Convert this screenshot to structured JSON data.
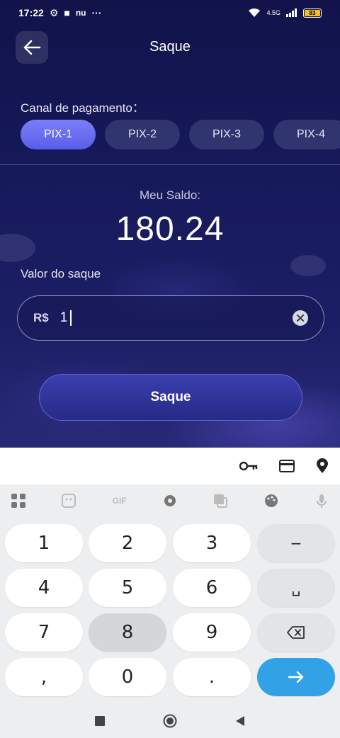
{
  "status_bar": {
    "time": "17:22",
    "network": "4.5G",
    "battery": "83"
  },
  "header": {
    "back_icon": "arrow-left-icon",
    "title": "Saque"
  },
  "payment": {
    "label": "Canal de pagamento：",
    "channels": [
      "PIX-1",
      "PIX-2",
      "PIX-3",
      "PIX-4"
    ],
    "active_index": 0
  },
  "balance": {
    "label": "Meu Saldo:",
    "value": "180.24"
  },
  "withdraw": {
    "label": "Valor do saque",
    "currency": "R$",
    "value": "1",
    "submit_label": "Saque"
  },
  "keyboard": {
    "suggestion_icons": [
      "key-icon",
      "card-icon",
      "location-pin-icon"
    ],
    "tool_icons": [
      "apps-grid-icon",
      "sticker-icon",
      "gif-icon",
      "settings-gear-icon",
      "translate-icon",
      "palette-icon",
      "microphone-icon"
    ],
    "gif_label": "GIF",
    "keys": {
      "k1": "1",
      "k2": "2",
      "k3": "3",
      "minus": "−",
      "k4": "4",
      "k5": "5",
      "k6": "6",
      "space": "␣",
      "k7": "7",
      "k8": "8",
      "k9": "9",
      "comma": ",",
      "k0": "0",
      "dot": "."
    }
  },
  "colors": {
    "accent": "#6a6ef2",
    "enter_key": "#32a2e6",
    "background": "#11134a"
  }
}
